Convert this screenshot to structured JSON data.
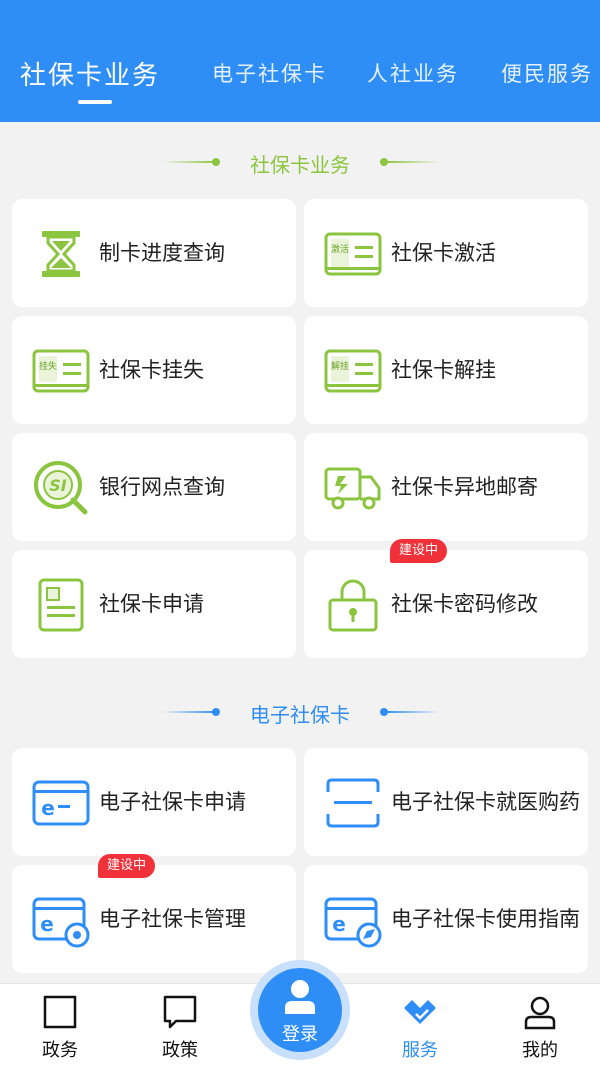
{
  "colors": {
    "brand": "#2f8ef5",
    "accent_green": "#8bc53f",
    "badge_red": "#f0313a"
  },
  "tabs": [
    {
      "label": "社保卡业务",
      "active": true
    },
    {
      "label": "电子社保卡"
    },
    {
      "label": "人社业务"
    },
    {
      "label": "便民服务"
    }
  ],
  "sections": {
    "social_card": {
      "title": "社保卡业务",
      "items": [
        {
          "label": "制卡进度查询",
          "icon": "hourglass-icon"
        },
        {
          "label": "社保卡激活",
          "icon": "card-activate-icon",
          "icon_text": "激活"
        },
        {
          "label": "社保卡挂失",
          "icon": "card-report-loss-icon",
          "icon_text": "挂失"
        },
        {
          "label": "社保卡解挂",
          "icon": "card-unlock-icon",
          "icon_text": "解挂"
        },
        {
          "label": "银行网点查询",
          "icon": "bank-search-icon"
        },
        {
          "label": "社保卡异地邮寄",
          "icon": "delivery-truck-icon"
        },
        {
          "label": "社保卡申请",
          "icon": "card-apply-icon"
        },
        {
          "label": "社保卡密码修改",
          "icon": "lock-icon",
          "badge": "建设中"
        }
      ]
    },
    "e_card": {
      "title": "电子社保卡",
      "items": [
        {
          "label": "电子社保卡申请",
          "icon": "ecard-apply-icon"
        },
        {
          "label": "电子社保卡就医购药",
          "icon": "scan-icon"
        },
        {
          "label": "电子社保卡管理",
          "icon": "ecard-settings-icon",
          "badge": "建设中"
        },
        {
          "label": "电子社保卡使用指南",
          "icon": "ecard-guide-icon"
        }
      ]
    }
  },
  "bottom_nav": {
    "items": [
      {
        "label": "政务",
        "icon": "square-icon"
      },
      {
        "label": "政策",
        "icon": "chat-bubble-icon"
      },
      {
        "label": "服务",
        "icon": "service-check-icon",
        "active": true
      },
      {
        "label": "我的",
        "icon": "user-icon"
      }
    ],
    "login": {
      "label": "登录",
      "icon": "user-icon"
    }
  }
}
